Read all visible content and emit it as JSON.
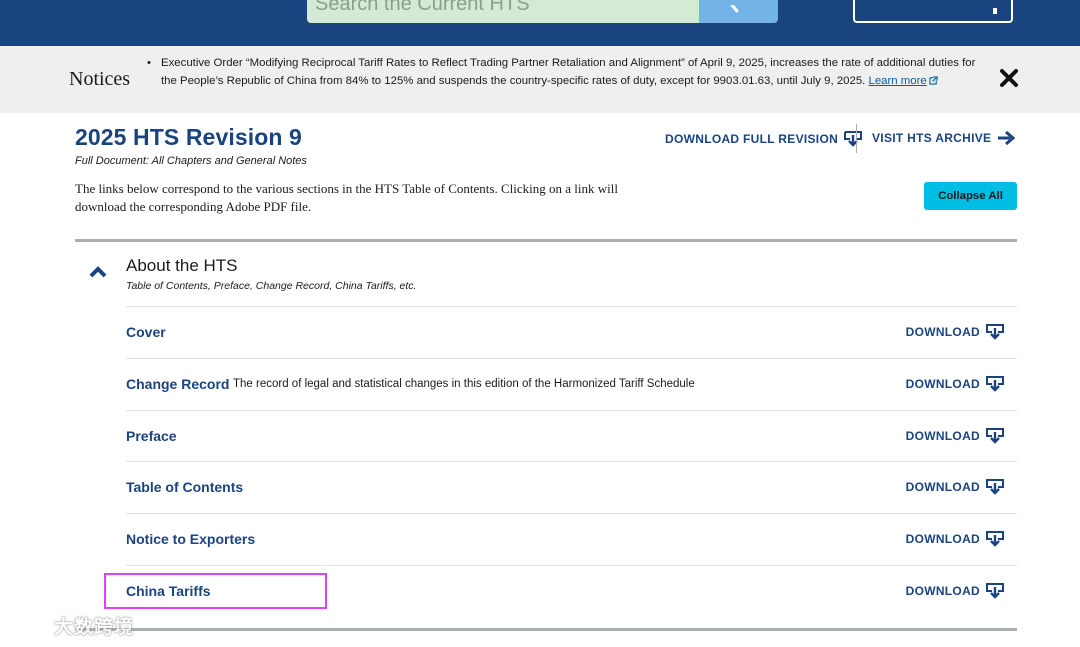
{
  "header": {
    "search_placeholder": "Search the Current HTS"
  },
  "notices": {
    "title": "Notices",
    "bullet": "•",
    "text": "Executive Order “Modifying Reciprocal Tariff Rates to Reflect Trading Partner Retaliation and Alignment” of April 9, 2025, increases the rate of additional duties for the People’s Republic of China from 84% to 125% and suspends the country-specific rates of duty, except for 9903.01.63, until July 9, 2025.",
    "link_label": "Learn more"
  },
  "page": {
    "title": "2025 HTS Revision 9",
    "subtitle": "Full Document: All Chapters and General Notes",
    "download_full_label": "DOWNLOAD FULL REVISION",
    "archive_label": "VISIT HTS ARCHIVE",
    "intro": "The links below correspond to the various sections in the HTS Table of Contents. Clicking on a link will download the corresponding Adobe PDF file.",
    "collapse_label": "Collapse All"
  },
  "section": {
    "title": "About the HTS",
    "subtitle": "Table of Contents, Preface, Change Record, China Tariffs, etc.",
    "rows": [
      {
        "label": "Cover",
        "description": "",
        "download": "DOWNLOAD"
      },
      {
        "label": "Change Record",
        "description": "The record of legal and statistical changes in this edition of the Harmonized Tariff Schedule",
        "download": "DOWNLOAD"
      },
      {
        "label": "Preface",
        "description": "",
        "download": "DOWNLOAD"
      },
      {
        "label": "Table of Contents",
        "description": "",
        "download": "DOWNLOAD"
      },
      {
        "label": "Notice to Exporters",
        "description": "",
        "download": "DOWNLOAD"
      },
      {
        "label": "China Tariffs",
        "description": "",
        "download": "DOWNLOAD"
      }
    ]
  },
  "watermark": "大数跨境",
  "colors": {
    "brand_navy": "#1a4480",
    "link_blue": "#005ea2",
    "collapse_button": "#00bde3",
    "highlight": "#e040fb"
  }
}
